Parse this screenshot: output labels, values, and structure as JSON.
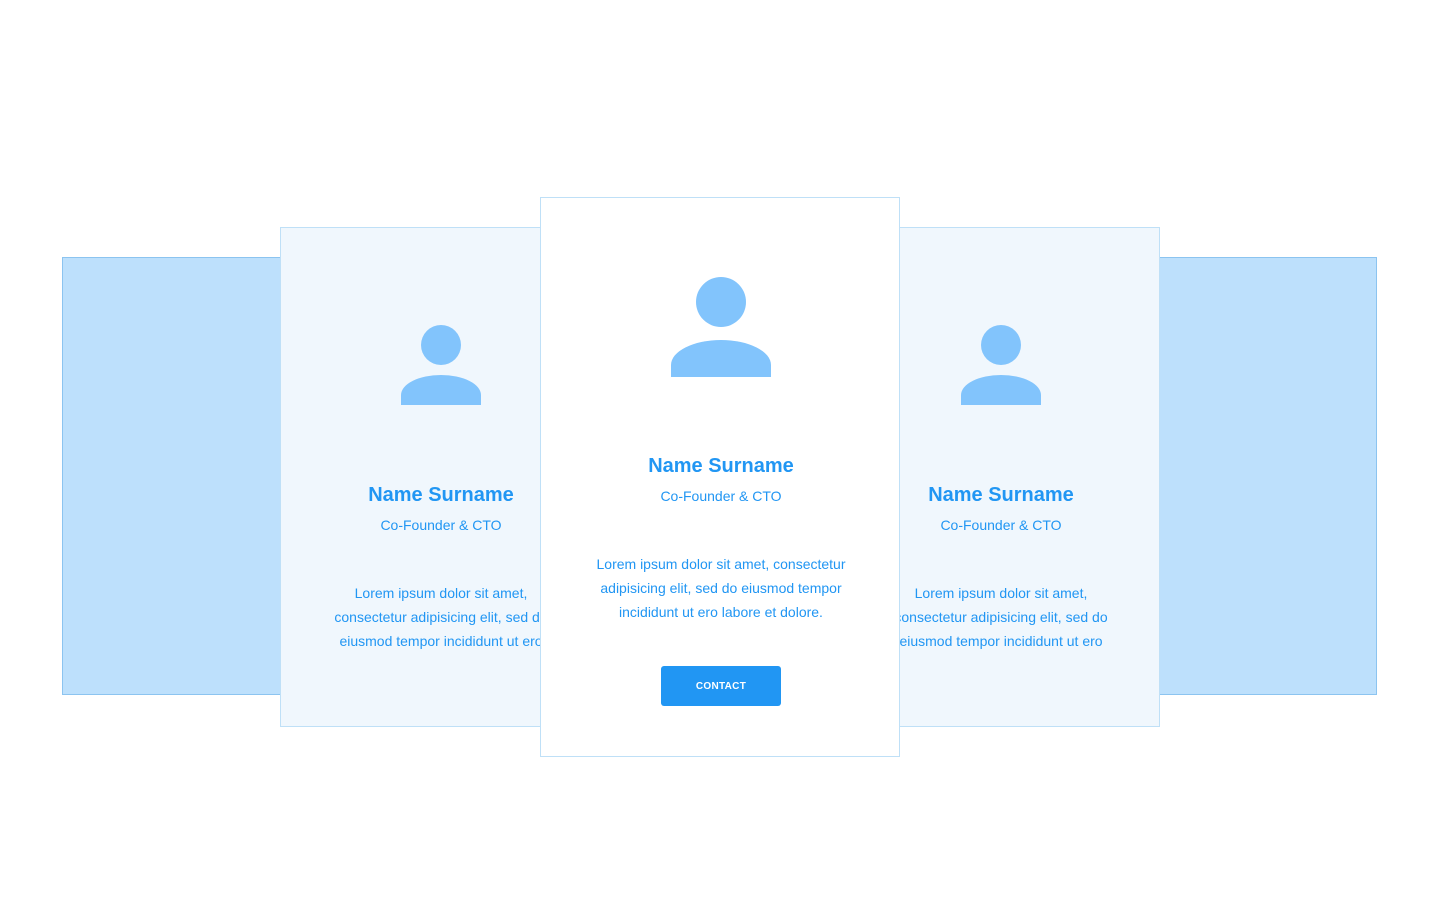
{
  "colors": {
    "accent": "#2196f3",
    "avatar": "#82c4fc",
    "backdrop": "#bde0fc",
    "side_card_bg": "#f0f7fd",
    "card_border": "#bfe0f7"
  },
  "cards": [
    {
      "icon": "user-icon",
      "name": "Name Surname",
      "role": "Co-Founder & CTO",
      "bio": "Lorem ipsum dolor sit amet, consectetur adipisicing elit, sed do eiusmod tempor incididunt ut ero"
    },
    {
      "icon": "user-icon",
      "name": "Name Surname",
      "role": "Co-Founder & CTO",
      "bio": "Lorem ipsum dolor sit amet, consectetur adipisicing elit, sed do eiusmod tempor incididunt ut ero labore et dolore.",
      "button_label": "CONTACT"
    },
    {
      "icon": "user-icon",
      "name": "Name Surname",
      "role": "Co-Founder & CTO",
      "bio": "Lorem ipsum dolor sit amet, consectetur adipisicing elit, sed do eiusmod tempor incididunt ut ero"
    }
  ]
}
